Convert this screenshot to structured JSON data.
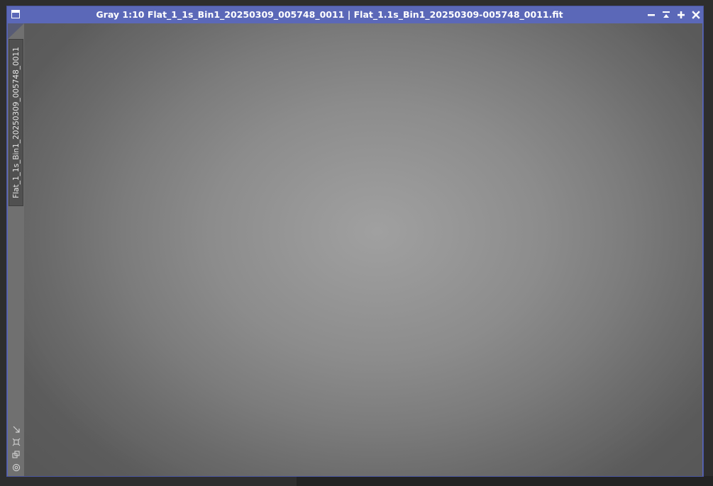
{
  "window": {
    "title": "Gray 1:10 Flat_1_1s_Bin1_20250309_005748_0011 | Flat_1.1s_Bin1_20250309-005748_0011.fit",
    "buttons": {
      "minimize": "minimize-icon",
      "shade": "shade-icon",
      "maximize": "maximize-icon",
      "close": "close-icon"
    }
  },
  "sidebar": {
    "tab_label": "Flat_1_1s_Bin1_20250309_005748_0011",
    "tools": [
      "zoom-to-fit-icon",
      "fit-window-icon",
      "clone-view-icon",
      "target-icon"
    ]
  },
  "colors": {
    "titlebar": "#5b68b8",
    "frame": "#5a67b5",
    "image_center": "#a0a0a0",
    "image_edge": "#5e5e5e",
    "sidebar": "#707070"
  }
}
